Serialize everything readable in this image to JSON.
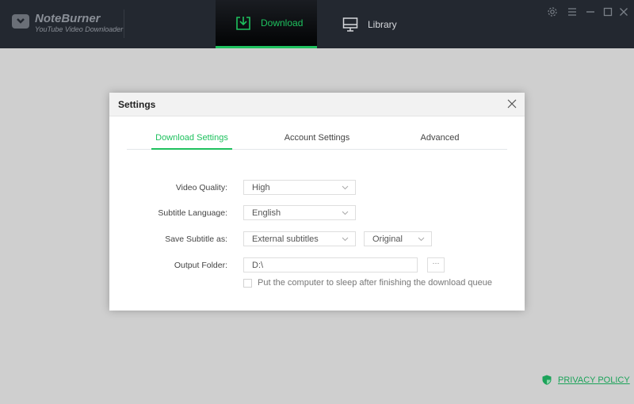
{
  "app": {
    "name": "NoteBurner",
    "subtitle": "YouTube Video Downloader"
  },
  "nav": {
    "tabs": [
      {
        "label": "Download",
        "icon": "download-icon",
        "active": true
      },
      {
        "label": "Library",
        "icon": "monitor-icon",
        "active": false
      }
    ]
  },
  "window_controls": [
    "gear-icon",
    "menu-icon",
    "minimize-icon",
    "maximize-icon",
    "close-icon"
  ],
  "dialog": {
    "title": "Settings",
    "tabs": [
      {
        "label": "Download Settings",
        "active": true
      },
      {
        "label": "Account Settings",
        "active": false
      },
      {
        "label": "Advanced",
        "active": false
      }
    ],
    "fields": {
      "video_quality": {
        "label": "Video Quality:",
        "value": "High"
      },
      "subtitle_language": {
        "label": "Subtitle Language:",
        "value": "English"
      },
      "save_subtitle_as": {
        "label": "Save Subtitle as:",
        "value": "External subtitles",
        "value2": "Original"
      },
      "output_folder": {
        "label": "Output Folder:",
        "value": "D:\\",
        "browse_label": "···"
      },
      "sleep_option": {
        "label": "Put the computer to sleep after finishing the download queue",
        "checked": false
      }
    }
  },
  "footer": {
    "privacy_label": "PRIVACY POLICY"
  },
  "colors": {
    "accent": "#1ec15e",
    "titlebar": "#232830",
    "backdrop": "#cfcfcf"
  }
}
